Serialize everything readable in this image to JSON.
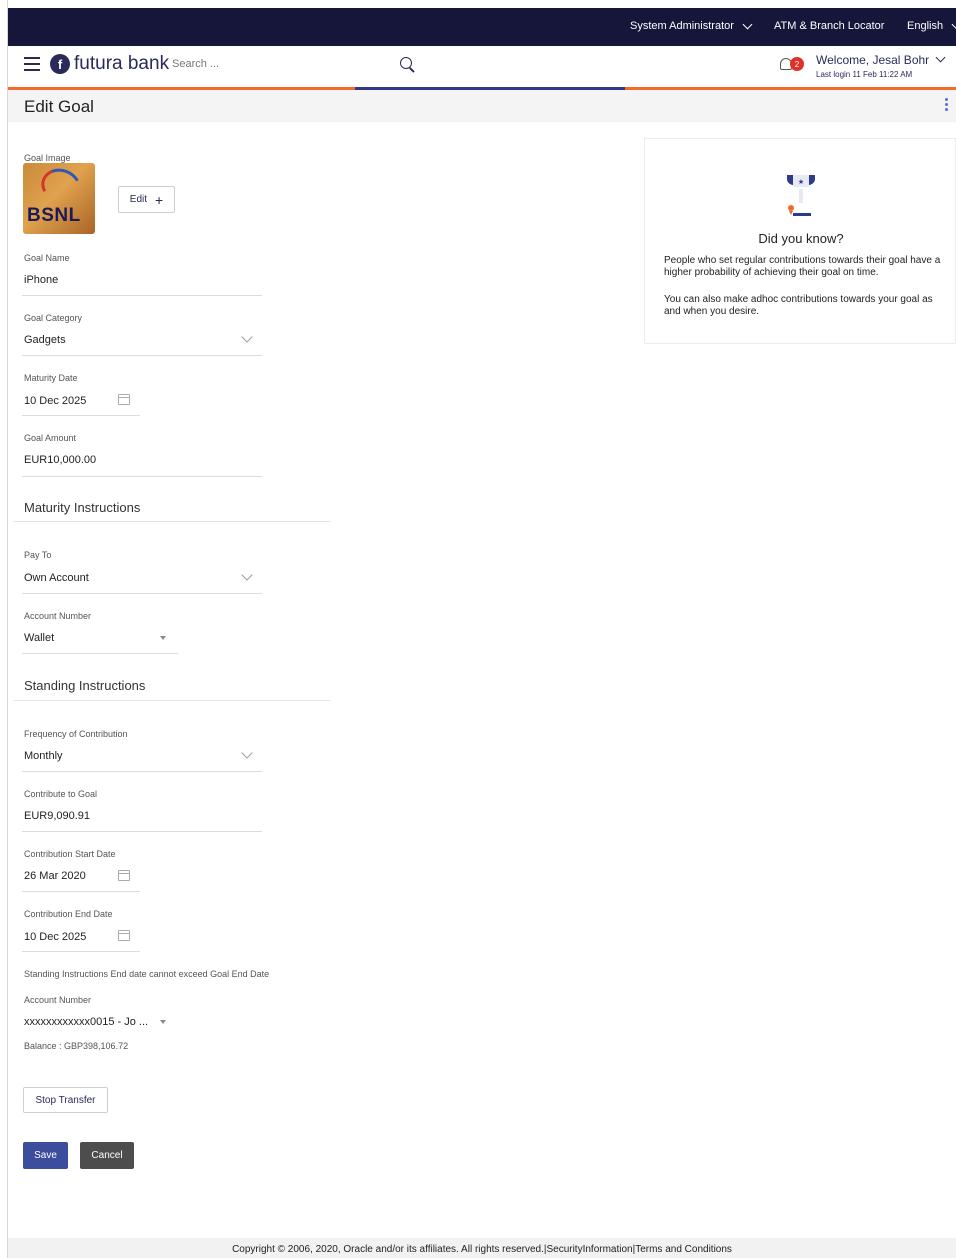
{
  "topbar": {
    "role": "System Administrator",
    "locator": "ATM & Branch Locator",
    "language": "English"
  },
  "header": {
    "brand": "futura bank",
    "search_placeholder": "Search ...",
    "notification_count": "2",
    "welcome": "Welcome, Jesal Bohr",
    "last_login": "Last login 11 Feb 11:22 AM"
  },
  "colors": {
    "topbar": "#16163a",
    "brand": "#2a2a5a",
    "accent_orange": "#f26b2a",
    "accent_navy": "#2e3a8c",
    "button_primary": "#3d4d9e",
    "button_secondary": "#4d4d4d"
  },
  "page": {
    "title": "Edit Goal"
  },
  "goal": {
    "image_label": "Goal Image",
    "image_text": "BSNL",
    "edit_label": "Edit",
    "name_label": "Goal Name",
    "name_value": "iPhone",
    "category_label": "Goal Category",
    "category_value": "Gadgets",
    "maturity_label": "Maturity Date",
    "maturity_value": "10 Dec 2025",
    "amount_label": "Goal Amount",
    "amount_value": "EUR10,000.00"
  },
  "maturity": {
    "heading": "Maturity Instructions",
    "pay_to_label": "Pay To",
    "pay_to_value": "Own Account",
    "account_label": "Account Number",
    "account_value": "Wallet"
  },
  "standing": {
    "heading": "Standing Instructions",
    "frequency_label": "Frequency of Contribution",
    "frequency_value": "Monthly",
    "contribute_label": "Contribute to Goal",
    "contribute_value": "EUR9,090.91",
    "start_label": "Contribution Start Date",
    "start_value": "26 Mar 2020",
    "end_label": "Contribution End Date",
    "end_value": "10 Dec 2025",
    "note": "Standing Instructions End date cannot exceed Goal End Date",
    "account_label": "Account Number",
    "account_value": "xxxxxxxxxxxx0015 - Jo ...",
    "balance": "Balance : GBP398,106.72"
  },
  "actions": {
    "stop_transfer": "Stop Transfer",
    "save": "Save",
    "cancel": "Cancel"
  },
  "info": {
    "title": "Did you know?",
    "p1": "People who set regular contributions towards their goal have a higher probability of achieving their goal on time.",
    "p2": "You can also make adhoc contributions towards your goal as and when you desire."
  },
  "footer": {
    "text": "Copyright © 2006, 2020, Oracle and/or its affiliates. All rights reserved.|SecurityInformation|Terms and Conditions"
  }
}
